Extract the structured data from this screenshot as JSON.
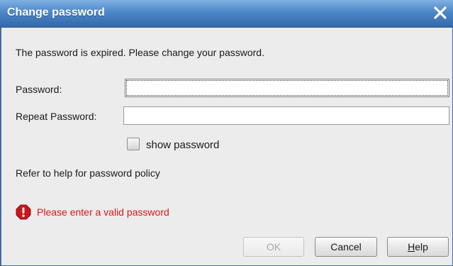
{
  "window": {
    "title": "Change password",
    "close_icon": "close-icon"
  },
  "message": "The password is expired. Please change your password.",
  "form": {
    "password_label": "Password:",
    "password_value": "",
    "repeat_label": "Repeat Password:",
    "repeat_value": "",
    "show_password_label": "show password",
    "show_password_checked": false
  },
  "policy_text": "Refer to help for password policy",
  "error": {
    "icon": "error-icon",
    "text": "Please enter a valid password",
    "color": "#e01414"
  },
  "buttons": {
    "ok_label": "OK",
    "ok_enabled": false,
    "cancel_label": "Cancel",
    "help_mnemonic": "H",
    "help_rest": "elp"
  },
  "colors": {
    "titlebar": "#4d86c7",
    "dialog_bg": "#ececec"
  }
}
